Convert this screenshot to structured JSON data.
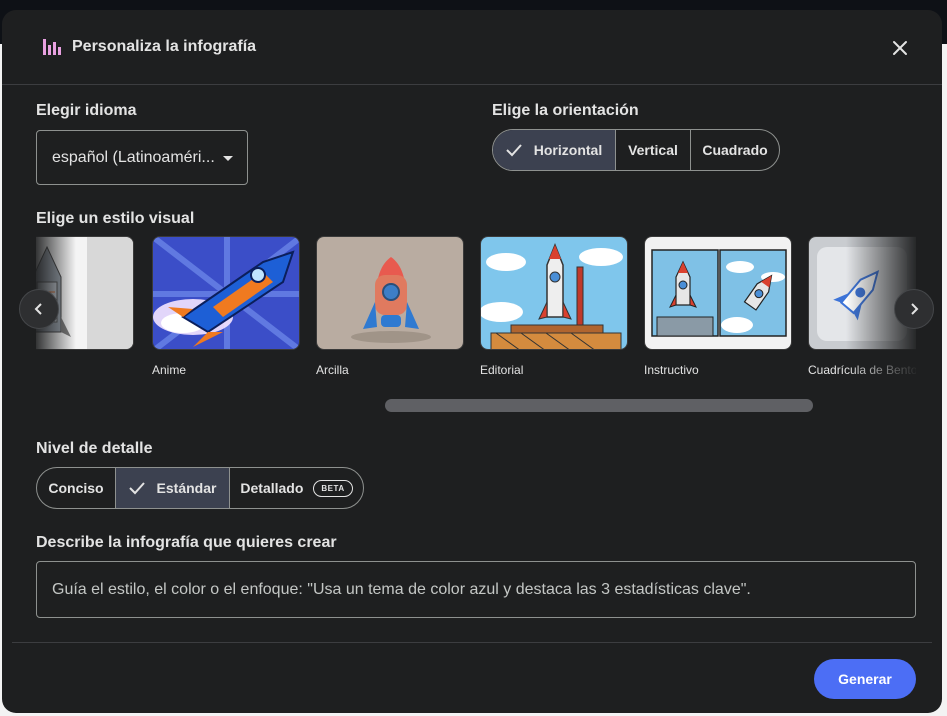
{
  "header": {
    "title": "Personaliza la infografía",
    "icon": "bar-chart-icon",
    "close_icon": "close-icon"
  },
  "language": {
    "label": "Elegir idioma",
    "value": "español (Latinoaméri..."
  },
  "orientation": {
    "label": "Elige la orientación",
    "options": [
      "Horizontal",
      "Vertical",
      "Cuadrado"
    ],
    "selected": "Horizontal"
  },
  "style": {
    "label": "Elige un estilo visual",
    "cards": [
      {
        "label": ""
      },
      {
        "label": "Anime"
      },
      {
        "label": "Arcilla"
      },
      {
        "label": "Editorial"
      },
      {
        "label": "Instructivo"
      },
      {
        "label": "Cuadrícula de Bento"
      }
    ]
  },
  "detail": {
    "label": "Nivel de detalle",
    "options": [
      "Conciso",
      "Estándar",
      "Detallado"
    ],
    "selected": "Estándar",
    "beta_badge": "BETA"
  },
  "describe": {
    "label": "Describe la infografía que quieres crear",
    "placeholder": "Guía el estilo, el color o el enfoque: \"Usa un tema de color azul y destaca las 3 estadísticas clave\"."
  },
  "footer": {
    "generate_label": "Generar"
  },
  "colors": {
    "accent": "#4c6ef5",
    "selected_segment": "#3c4150",
    "dialog_bg": "#1e1f20"
  }
}
